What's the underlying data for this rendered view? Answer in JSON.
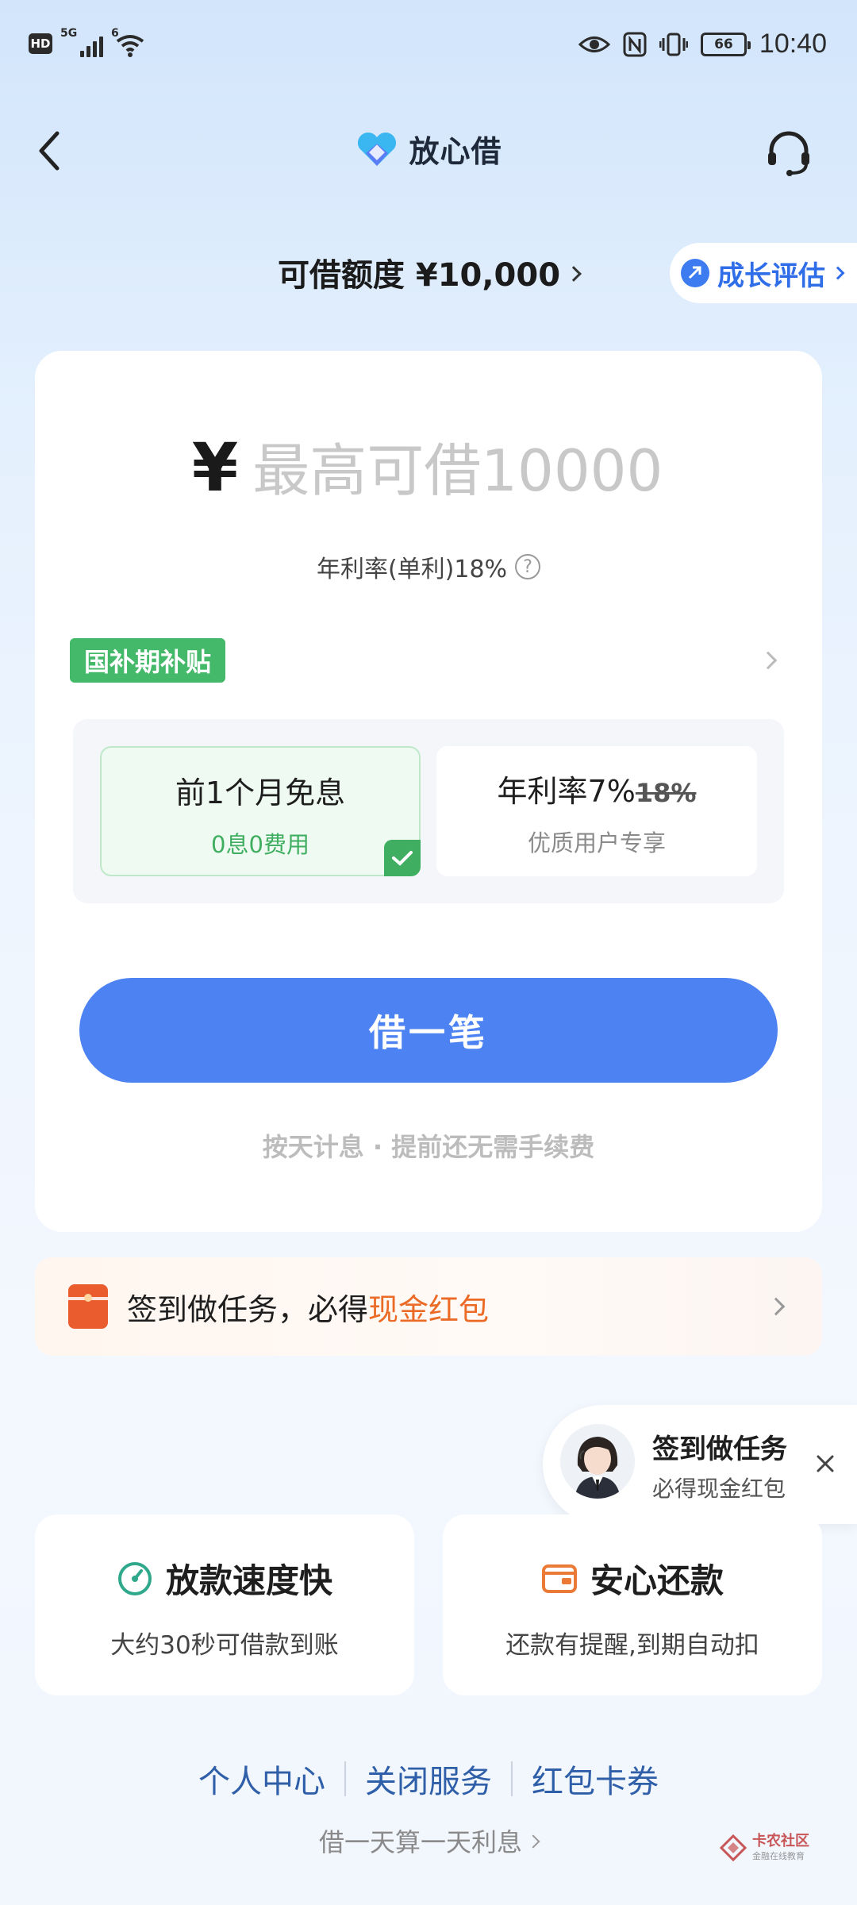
{
  "status_bar": {
    "hd": "HD",
    "signal_tag": "5G",
    "wifi_tag": "6",
    "battery": "66",
    "time": "10:40"
  },
  "header": {
    "brand": "放心借"
  },
  "quota": {
    "label": "可借额度 ¥10,000",
    "growth_label": "成长评估"
  },
  "loan": {
    "currency": "¥",
    "amount_placeholder": "最高可借10000",
    "rate_text": "年利率(单利)18%",
    "help": "?",
    "subsidy_tag": "国补期补贴",
    "options": [
      {
        "title": "前1个月免息",
        "sub": "0息0费用",
        "selected": true
      },
      {
        "title_main": "年利率7%",
        "title_strike": "18%",
        "sub": "优质用户专享",
        "selected": false
      }
    ],
    "borrow_button": "借一笔",
    "note": "按天计息 · 提前还无需手续费"
  },
  "task_banner": {
    "text_prefix": "签到做任务，必得",
    "text_highlight": "现金红包"
  },
  "float_task": {
    "title": "签到做任务",
    "sub": "必得现金红包"
  },
  "features": [
    {
      "title": "放款速度快",
      "sub": "大约30秒可借款到账",
      "icon": "speed-dial-icon"
    },
    {
      "title": "安心还款",
      "sub": "还款有提醒,到期自动扣",
      "icon": "wallet-icon"
    }
  ],
  "links": [
    "个人中心",
    "关闭服务",
    "红包卡券"
  ],
  "foot_note": "借一天算一天利息",
  "watermark": {
    "title": "卡农社区",
    "sub": "金融在线教育"
  },
  "colors": {
    "primary": "#4d82f2",
    "green": "#3fae60",
    "orange": "#ea6a26",
    "link": "#2f5fa8"
  }
}
